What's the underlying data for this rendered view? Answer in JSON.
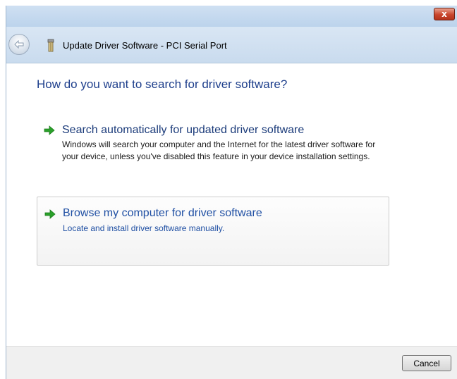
{
  "window": {
    "close_symbol": "x"
  },
  "nav": {
    "title": "Update Driver Software - PCI Serial Port",
    "back_icon": "back-arrow-icon",
    "device_icon": "device-icon"
  },
  "main": {
    "heading": "How do you want to search for driver software?",
    "options": [
      {
        "title": "Search automatically for updated driver software",
        "description": "Windows will search your computer and the Internet for the latest driver software for your device, unless you've disabled this feature in your device installation settings.",
        "icon": "green-arrow-icon"
      },
      {
        "title": "Browse my computer for driver software",
        "description": "Locate and install driver software manually.",
        "icon": "green-arrow-icon"
      }
    ]
  },
  "footer": {
    "cancel_label": "Cancel"
  },
  "colors": {
    "heading": "#1e3f8c",
    "link": "#1f4fa3",
    "arrow": "#2aa12a",
    "close": "#c9452d"
  }
}
